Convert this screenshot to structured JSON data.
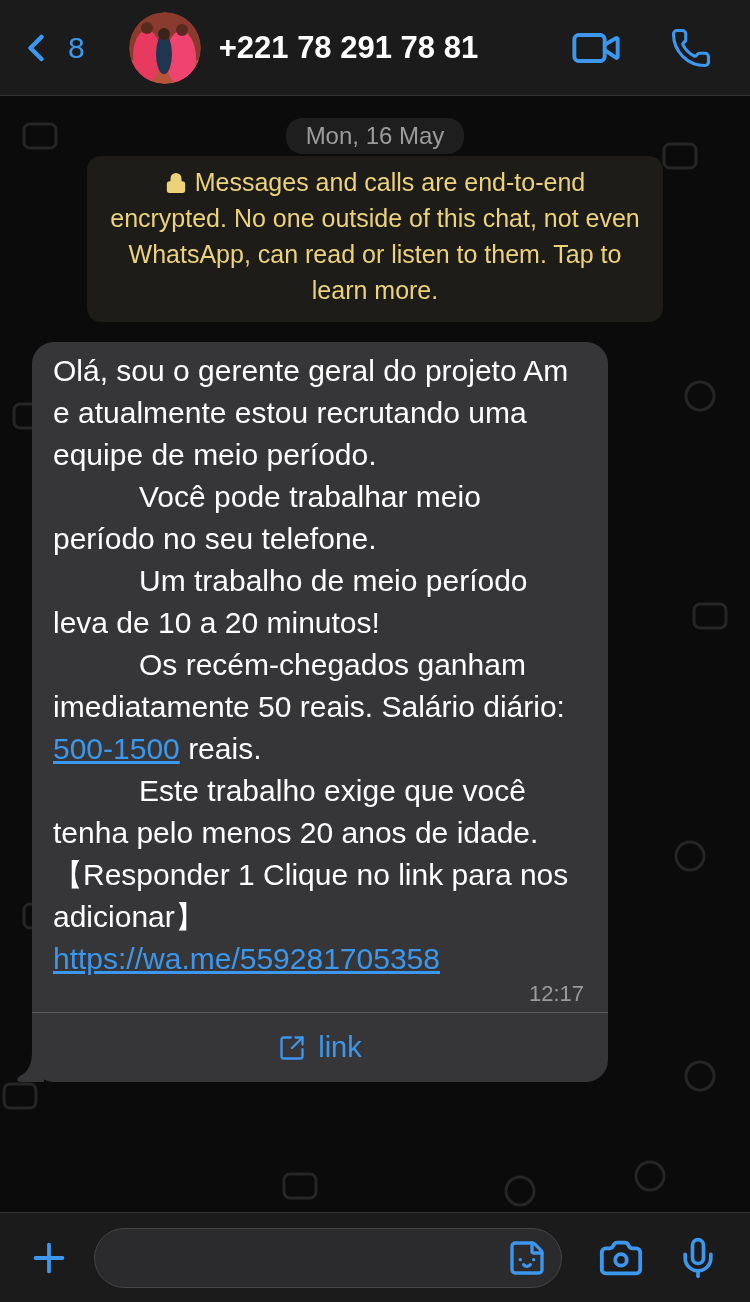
{
  "header": {
    "back_count": "8",
    "contact": "+221 78 291 78 81"
  },
  "date_chip": "Mon, 16 May",
  "encryption_notice": "Messages and calls are end-to-end encrypted. No one outside of this chat, not even WhatsApp, can read or listen to them. Tap to learn more.",
  "message": {
    "paragraphs": [
      {
        "indent": false,
        "parts": [
          {
            "kind": "text",
            "text": "Olá, sou o gerente geral do projeto Am e atualmente estou recrutando uma equipe de meio período."
          }
        ]
      },
      {
        "indent": true,
        "parts": [
          {
            "kind": "text",
            "text": "Você pode trabalhar meio período no seu telefone."
          }
        ]
      },
      {
        "indent": true,
        "parts": [
          {
            "kind": "text",
            "text": "Um trabalho de meio período leva de 10 a 20 minutos!"
          }
        ]
      },
      {
        "indent": true,
        "parts": [
          {
            "kind": "text",
            "text": "Os recém-chegados ganham imediatamente 50 reais. Salário diário: "
          },
          {
            "kind": "link",
            "text": "500-1500"
          },
          {
            "kind": "text",
            "text": " reais."
          }
        ]
      },
      {
        "indent": true,
        "parts": [
          {
            "kind": "text",
            "text": "Este trabalho exige que você tenha pelo menos 20 anos de idade."
          }
        ]
      },
      {
        "indent": false,
        "parts": [
          {
            "kind": "text",
            "text": "【Responder 1 Clique no link para nos adicionar】"
          }
        ]
      },
      {
        "indent": false,
        "parts": [
          {
            "kind": "link",
            "text": "https://wa.me/559281705358"
          }
        ]
      }
    ],
    "time": "12:17",
    "action": "link"
  }
}
